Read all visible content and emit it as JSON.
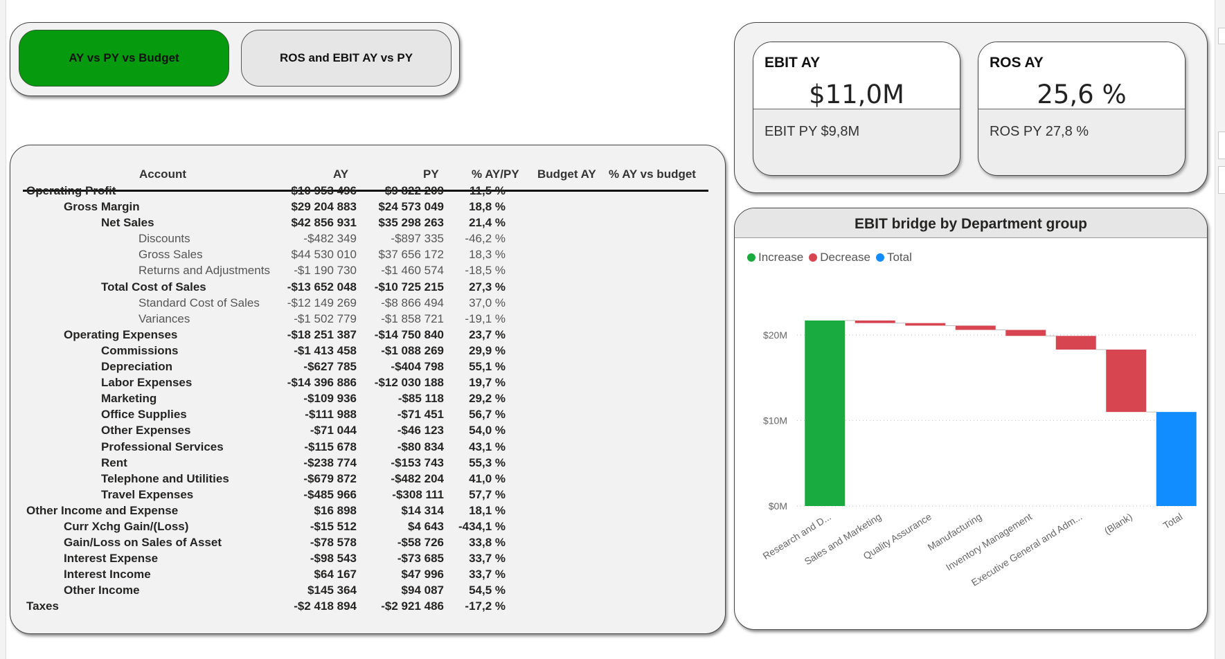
{
  "nav": {
    "btn_active_label": "AY vs PY vs Budget",
    "btn_inactive_label": "ROS and EBIT AY vs PY"
  },
  "table": {
    "headers": {
      "account": "Account",
      "ay": "AY",
      "py": "PY",
      "pct": "% AY/PY",
      "budget": "Budget AY",
      "pct_budget": "% AY vs budget"
    },
    "rows": [
      {
        "account": "Operating Profit",
        "level": 0,
        "ay": "$10 953 496",
        "py": "$9 822 209",
        "pct": "11,5 %"
      },
      {
        "account": "Gross Margin",
        "level": 1,
        "ay": "$29 204 883",
        "py": "$24 573 049",
        "pct": "18,8 %"
      },
      {
        "account": "Net Sales",
        "level": 2,
        "ay": "$42 856 931",
        "py": "$35 298 263",
        "pct": "21,4 %"
      },
      {
        "account": "Discounts",
        "level": 3,
        "ay": "-$482 349",
        "py": "-$897 335",
        "pct": "-46,2 %"
      },
      {
        "account": "Gross Sales",
        "level": 3,
        "ay": "$44 530 010",
        "py": "$37 656 172",
        "pct": "18,3 %"
      },
      {
        "account": "Returns and Adjustments",
        "level": 3,
        "ay": "-$1 190 730",
        "py": "-$1 460 574",
        "pct": "-18,5 %"
      },
      {
        "account": "Total Cost of Sales",
        "level": 2,
        "ay": "-$13 652 048",
        "py": "-$10 725 215",
        "pct": "27,3 %"
      },
      {
        "account": "Standard Cost of Sales",
        "level": 3,
        "ay": "-$12 149 269",
        "py": "-$8 866 494",
        "pct": "37,0 %"
      },
      {
        "account": "Variances",
        "level": 3,
        "ay": "-$1 502 779",
        "py": "-$1 858 721",
        "pct": "-19,1 %"
      },
      {
        "account": "Operating Expenses",
        "level": 1,
        "ay": "-$18 251 387",
        "py": "-$14 750 840",
        "pct": "23,7 %"
      },
      {
        "account": "Commissions",
        "level": 2,
        "ay": "-$1 413 458",
        "py": "-$1 088 269",
        "pct": "29,9 %"
      },
      {
        "account": "Depreciation",
        "level": 2,
        "ay": "-$627 785",
        "py": "-$404 798",
        "pct": "55,1 %"
      },
      {
        "account": "Labor Expenses",
        "level": 2,
        "ay": "-$14 396 886",
        "py": "-$12 030 188",
        "pct": "19,7 %"
      },
      {
        "account": "Marketing",
        "level": 2,
        "ay": "-$109 936",
        "py": "-$85 118",
        "pct": "29,2 %"
      },
      {
        "account": "Office Supplies",
        "level": 2,
        "ay": "-$111 988",
        "py": "-$71 451",
        "pct": "56,7 %"
      },
      {
        "account": "Other Expenses",
        "level": 2,
        "ay": "-$71 044",
        "py": "-$46 123",
        "pct": "54,0 %"
      },
      {
        "account": "Professional Services",
        "level": 2,
        "ay": "-$115 678",
        "py": "-$80 834",
        "pct": "43,1 %"
      },
      {
        "account": "Rent",
        "level": 2,
        "ay": "-$238 774",
        "py": "-$153 743",
        "pct": "55,3 %"
      },
      {
        "account": "Telephone and Utilities",
        "level": 2,
        "ay": "-$679 872",
        "py": "-$482 204",
        "pct": "41,0 %"
      },
      {
        "account": "Travel Expenses",
        "level": 2,
        "ay": "-$485 966",
        "py": "-$308 111",
        "pct": "57,7 %"
      },
      {
        "account": "Other Income and Expense",
        "level": 0,
        "ay": "$16 898",
        "py": "$14 314",
        "pct": "18,1 %"
      },
      {
        "account": "Curr Xchg Gain/(Loss)",
        "level": 1,
        "ay": "-$15 512",
        "py": "$4 643",
        "pct": "-434,1 %"
      },
      {
        "account": "Gain/Loss on Sales of Asset",
        "level": 1,
        "ay": "-$78 578",
        "py": "-$58 726",
        "pct": "33,8 %"
      },
      {
        "account": "Interest Expense",
        "level": 1,
        "ay": "-$98 543",
        "py": "-$73 685",
        "pct": "33,7 %"
      },
      {
        "account": "Interest Income",
        "level": 1,
        "ay": "$64 167",
        "py": "$47 996",
        "pct": "33,7 %"
      },
      {
        "account": "Other Income",
        "level": 1,
        "ay": "$145 364",
        "py": "$94 087",
        "pct": "54,5 %"
      },
      {
        "account": "Taxes",
        "level": 0,
        "ay": "-$2 418 894",
        "py": "-$2 921 486",
        "pct": "-17,2 %"
      }
    ]
  },
  "kpis": {
    "ebit": {
      "title": "EBIT AY",
      "value": "$11,0M",
      "sub": "EBIT PY $9,8M"
    },
    "ros": {
      "title": "ROS AY",
      "value": "25,6 %",
      "sub": "ROS PY 27,8 %"
    }
  },
  "chart": {
    "title": "EBIT bridge by Department group",
    "legend": [
      {
        "label": "Increase",
        "color": "#1aab40"
      },
      {
        "label": "Decrease",
        "color": "#d64550"
      },
      {
        "label": "Total",
        "color": "#118dff"
      }
    ]
  },
  "chart_data": {
    "type": "waterfall",
    "title": "EBIT bridge by Department group",
    "categories": [
      "Research and D...",
      "Sales and Marketing",
      "Quality Assurance",
      "Manufacturing",
      "Inventory Management",
      "Executive General and Adm...",
      "(Blank)",
      "Total"
    ],
    "values": [
      21.7,
      -0.3,
      -0.3,
      -0.5,
      -0.7,
      -1.6,
      -7.3,
      11.0
    ],
    "kinds": [
      "increase",
      "decrease",
      "decrease",
      "decrease",
      "decrease",
      "decrease",
      "decrease",
      "total"
    ],
    "y_ticks": [
      0,
      10,
      20
    ],
    "y_tick_labels": [
      "$0M",
      "$10M",
      "$20M"
    ],
    "ylim": [
      0,
      24
    ],
    "grid": true,
    "legend_position": "top-left"
  }
}
